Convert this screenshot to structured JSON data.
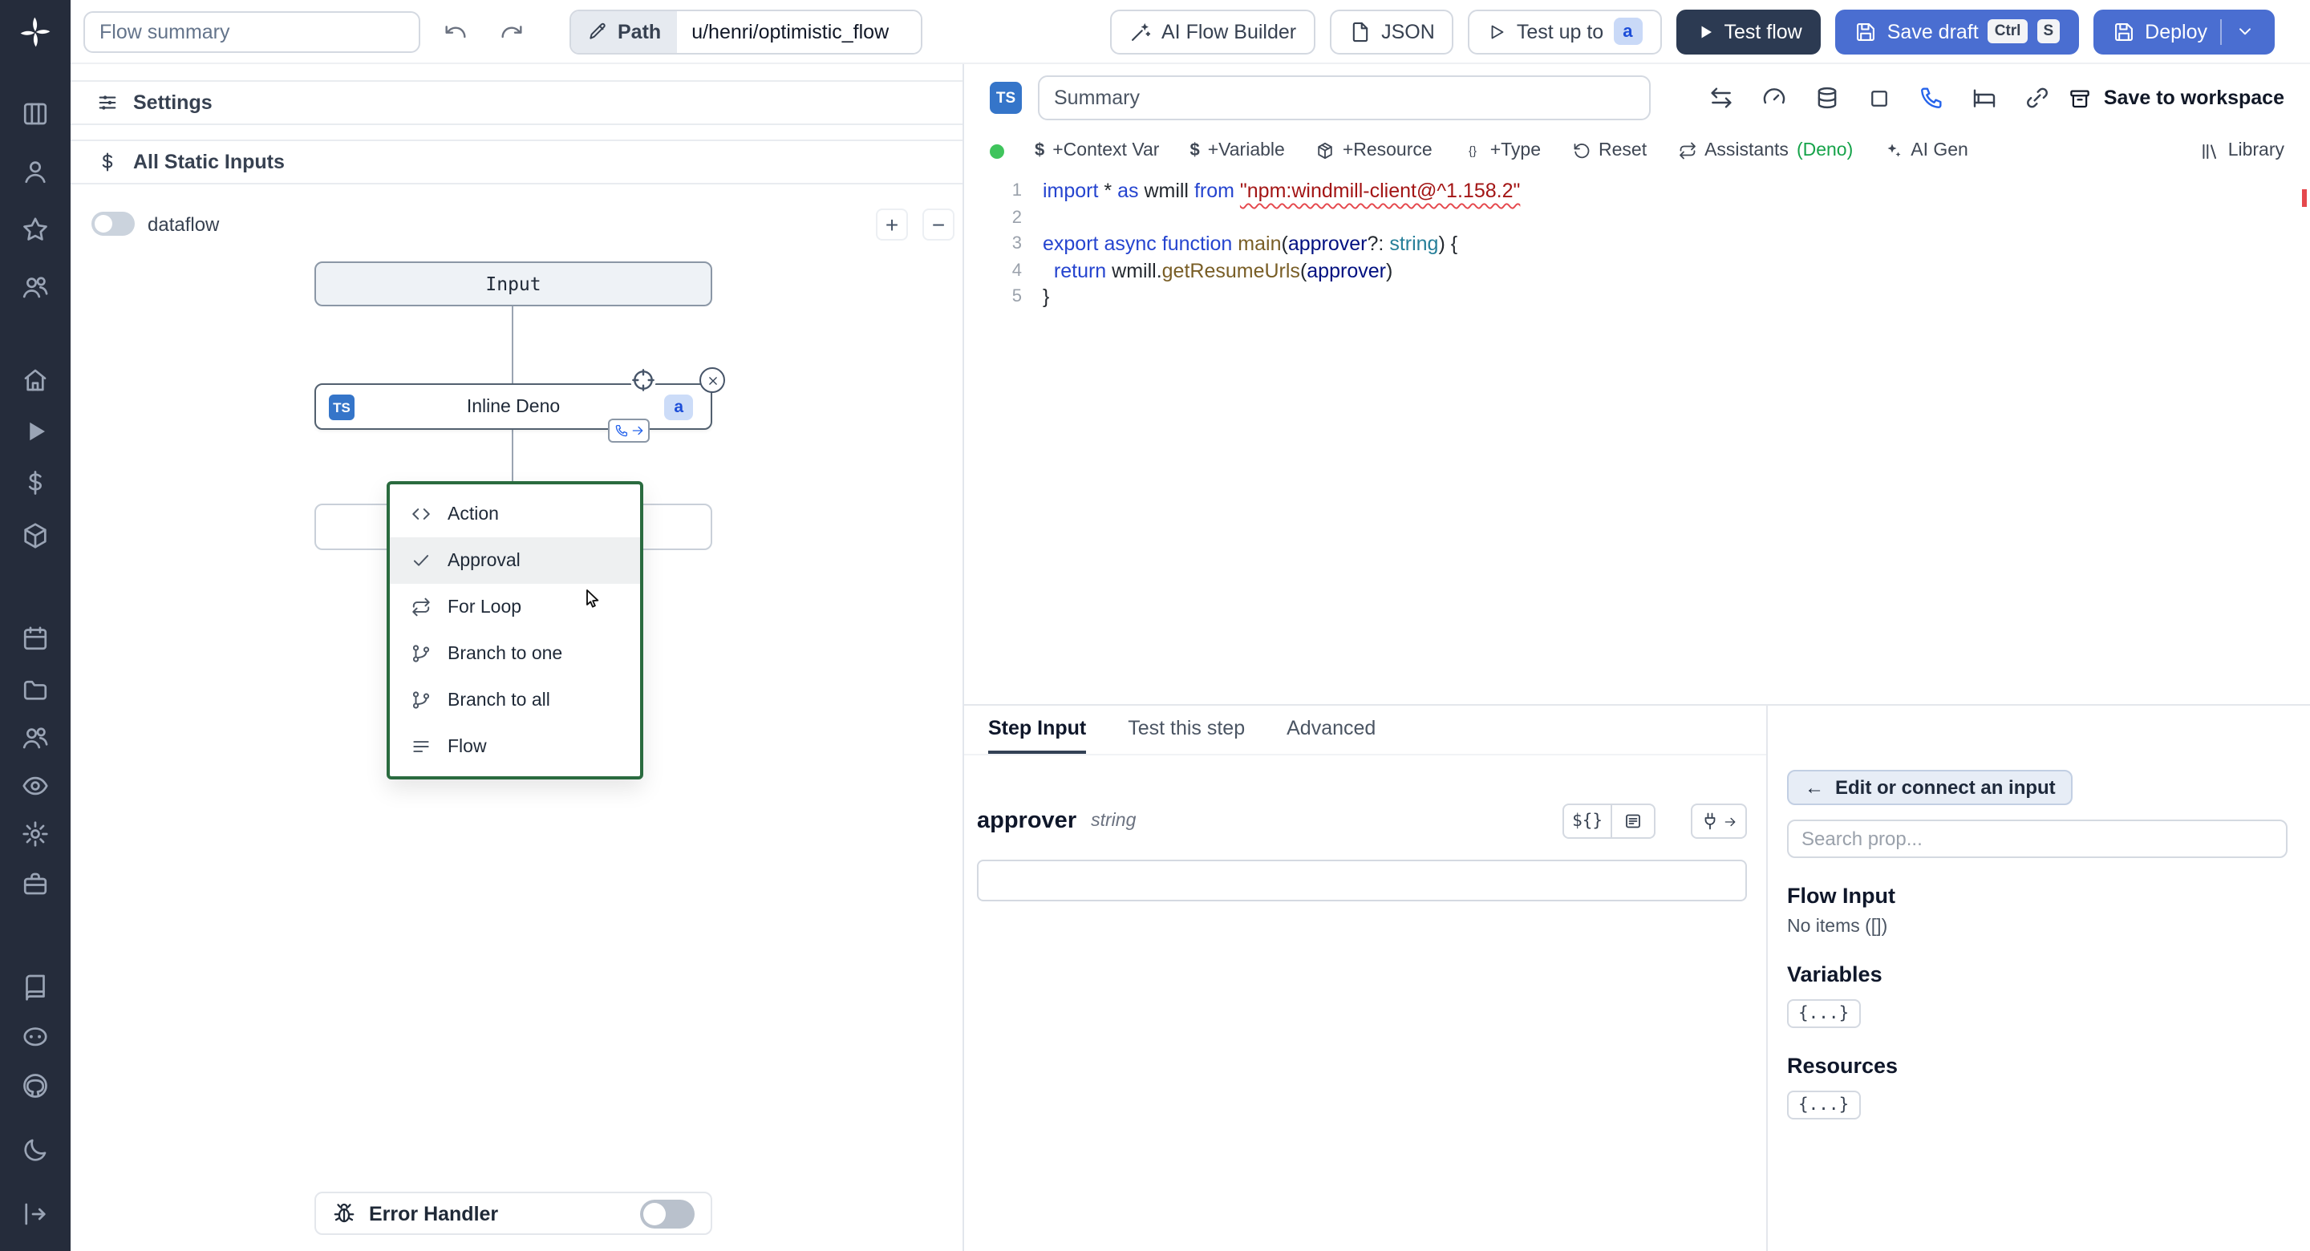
{
  "topbar": {
    "flow_summary_placeholder": "Flow summary",
    "path_label": "Path",
    "path_value": "u/henri/optimistic_flow",
    "ai_flow_builder_label": "AI Flow Builder",
    "json_label": "JSON",
    "test_up_to_label": "Test up to",
    "test_up_to_badge": "a",
    "test_flow_label": "Test flow",
    "save_draft_label": "Save draft",
    "kbd_ctrl": "Ctrl",
    "kbd_s": "S",
    "deploy_label": "Deploy"
  },
  "sidebar": {
    "icons": [
      "windmill-logo",
      "kanban-icon",
      "user-icon",
      "star-icon",
      "users-icon",
      "home-icon",
      "runs-icon",
      "variables-icon",
      "resources-icon",
      "schedules-icon",
      "folders-icon",
      "groups-icon",
      "audit-logs-icon",
      "settings-icon",
      "workers-icon",
      "docs-icon",
      "discord-icon",
      "github-icon",
      "dark-mode-icon",
      "expand-sidebar-icon"
    ]
  },
  "flow_panel": {
    "settings_label": "Settings",
    "static_inputs_label": "All Static Inputs",
    "dataflow_label": "dataflow",
    "zoom_in_label": "+",
    "zoom_out_label": "−",
    "input_node_label": "Input",
    "step_node": {
      "lang_badge": "TS",
      "label": "Inline Deno",
      "id_badge": "a"
    },
    "insert_menu": {
      "items": [
        {
          "icon": "code-icon",
          "label": "Action",
          "selected": false
        },
        {
          "icon": "check-icon",
          "label": "Approval",
          "selected": true
        },
        {
          "icon": "repeat-icon",
          "label": "For Loop",
          "selected": false
        },
        {
          "icon": "branch-one-icon",
          "label": "Branch to one",
          "selected": false
        },
        {
          "icon": "branch-all-icon",
          "label": "Branch to all",
          "selected": false
        },
        {
          "icon": "flow-icon",
          "label": "Flow",
          "selected": false
        }
      ]
    },
    "error_handler_label": "Error Handler"
  },
  "editor": {
    "lang_badge": "TS",
    "summary_placeholder": "Summary",
    "save_to_workspace_label": "Save to workspace",
    "toolbar": {
      "dollar_prefix": "$",
      "context_var_label": "+Context Var",
      "variable_label": "+Variable",
      "resource_label": "+Resource",
      "type_label": "+Type",
      "reset_label": "Reset",
      "assistants_label": "Assistants",
      "assistants_lang": "(Deno)",
      "ai_gen_label": "AI Gen",
      "library_label": "Library"
    },
    "code_lines": [
      {
        "n": 1,
        "tokens": [
          {
            "t": "import",
            "c": "kw"
          },
          {
            "t": " * ",
            "c": "pl"
          },
          {
            "t": "as",
            "c": "kw"
          },
          {
            "t": " wmill ",
            "c": "pl"
          },
          {
            "t": "from",
            "c": "kw"
          },
          {
            "t": " ",
            "c": "pl"
          },
          {
            "t": "\"npm:windmill-client@^1.158.2\"",
            "c": "str err"
          }
        ]
      },
      {
        "n": 2,
        "tokens": []
      },
      {
        "n": 3,
        "tokens": [
          {
            "t": "export",
            "c": "kw"
          },
          {
            "t": " ",
            "c": "pl"
          },
          {
            "t": "async",
            "c": "kw"
          },
          {
            "t": " ",
            "c": "pl"
          },
          {
            "t": "function",
            "c": "kw"
          },
          {
            "t": " ",
            "c": "pl"
          },
          {
            "t": "main",
            "c": "fn"
          },
          {
            "t": "(",
            "c": "pl"
          },
          {
            "t": "approver",
            "c": "var"
          },
          {
            "t": "?: ",
            "c": "pl"
          },
          {
            "t": "string",
            "c": "ty"
          },
          {
            "t": ") {",
            "c": "pl"
          }
        ]
      },
      {
        "n": 4,
        "tokens": [
          {
            "t": "  ",
            "c": "pl"
          },
          {
            "t": "return",
            "c": "kw"
          },
          {
            "t": " wmill.",
            "c": "pl"
          },
          {
            "t": "getResumeUrls",
            "c": "fn"
          },
          {
            "t": "(",
            "c": "pl"
          },
          {
            "t": "approver",
            "c": "var"
          },
          {
            "t": ")",
            "c": "pl"
          }
        ]
      },
      {
        "n": 5,
        "tokens": [
          {
            "t": "}",
            "c": "pl"
          }
        ]
      }
    ]
  },
  "step_panel": {
    "tabs": [
      {
        "label": "Step Input",
        "active": true
      },
      {
        "label": "Test this step",
        "active": false
      },
      {
        "label": "Advanced",
        "active": false
      }
    ],
    "field_name": "approver",
    "field_type": "string",
    "expr_button_label": "${}",
    "field_value": ""
  },
  "connect_panel": {
    "back_arrow": "←",
    "edit_connect_label": "Edit or connect an input",
    "search_placeholder": "Search prop...",
    "sections": [
      {
        "title": "Flow Input",
        "empty_text": "No items ([])"
      },
      {
        "title": "Variables",
        "chip_label": "{...}"
      },
      {
        "title": "Resources",
        "chip_label": "{...}"
      }
    ]
  }
}
